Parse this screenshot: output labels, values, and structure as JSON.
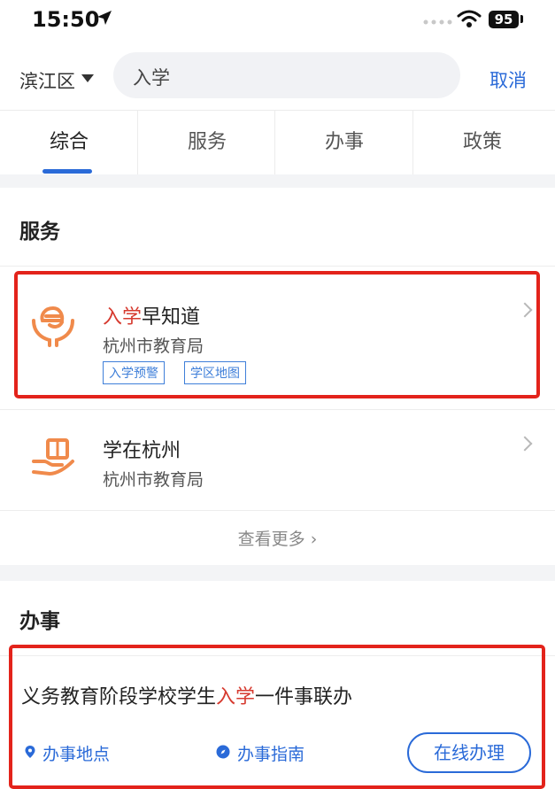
{
  "status": {
    "time": "15:50",
    "battery": "95"
  },
  "search": {
    "district": "滨江区",
    "query": "入学",
    "cancel_label": "取消"
  },
  "tabs": [
    {
      "label": "综合",
      "active": true
    },
    {
      "label": "服务",
      "active": false
    },
    {
      "label": "办事",
      "active": false
    },
    {
      "label": "政策",
      "active": false
    }
  ],
  "services": {
    "title": "服务",
    "items": [
      {
        "title_highlight": "入学",
        "title_rest": "早知道",
        "subtitle": "杭州市教育局",
        "tags": [
          "入学预警",
          "学区地图"
        ],
        "icon": "hands-e-icon"
      },
      {
        "title_highlight": "",
        "title_rest": "学在杭州",
        "subtitle": "杭州市教育局",
        "tags": [],
        "icon": "hand-book-icon"
      }
    ],
    "more_label": "查看更多"
  },
  "tasks": {
    "title": "办事",
    "item": {
      "title_before": "义务教育阶段学校学生",
      "title_highlight": "入学",
      "title_after": "一件事联办",
      "location_label": "办事地点",
      "guide_label": "办事指南",
      "online_label": "在线办理"
    }
  },
  "colors": {
    "accent": "#2a6ad8",
    "highlight": "#d63a2f",
    "annotation": "#e3231b",
    "icon_orange": "#f08a4b"
  }
}
